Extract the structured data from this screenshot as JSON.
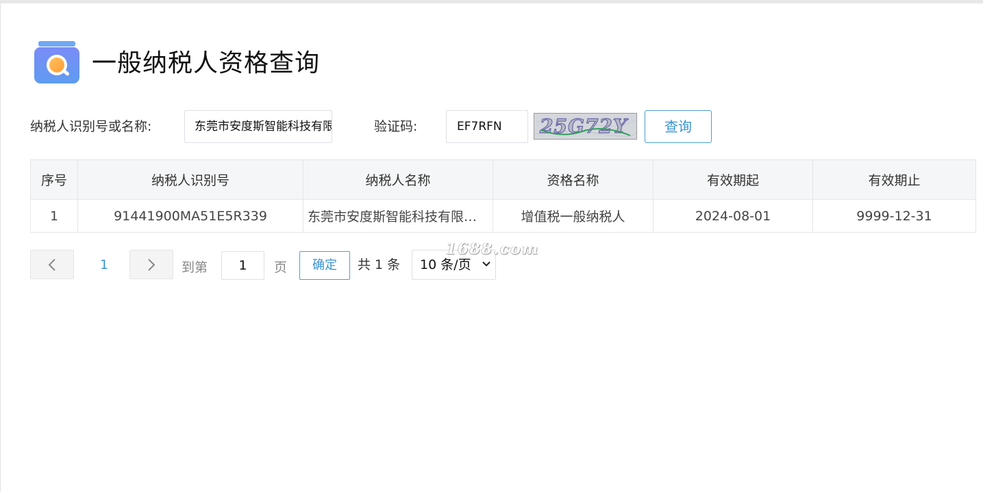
{
  "header": {
    "title": "一般纳税人资格查询"
  },
  "search": {
    "taxpayer_label": "纳税人识别号或名称:",
    "taxpayer_value": "东莞市安度斯智能科技有限",
    "captcha_label": "验证码:",
    "captcha_value": "EF7RFN",
    "captcha_image_text": "25G72Y",
    "query_label": "查询"
  },
  "table": {
    "columns": [
      "序号",
      "纳税人识别号",
      "纳税人名称",
      "资格名称",
      "有效期起",
      "有效期止"
    ],
    "rows": [
      {
        "index": "1",
        "tax_id": "91441900MA51E5R339",
        "name": "东莞市安度斯智能科技有限公司",
        "qualification": "增值税一般纳税人",
        "valid_from": "2024-08-01",
        "valid_to": "9999-12-31"
      }
    ]
  },
  "pager": {
    "current_page": "1",
    "goto_label": "到第",
    "goto_value": "1",
    "page_unit": "页",
    "confirm_label": "确定",
    "total_text": "共 1 条",
    "page_size": "10 条/页"
  },
  "watermark": "1688.com",
  "colors": {
    "accent": "#3a93cf",
    "border": "#dcdfe6",
    "header_bg": "#f5f6f7"
  },
  "icons": {
    "logo": "search-folder-icon",
    "prev": "chevron-left-icon",
    "next": "chevron-right-icon",
    "select": "chevron-down-icon"
  }
}
